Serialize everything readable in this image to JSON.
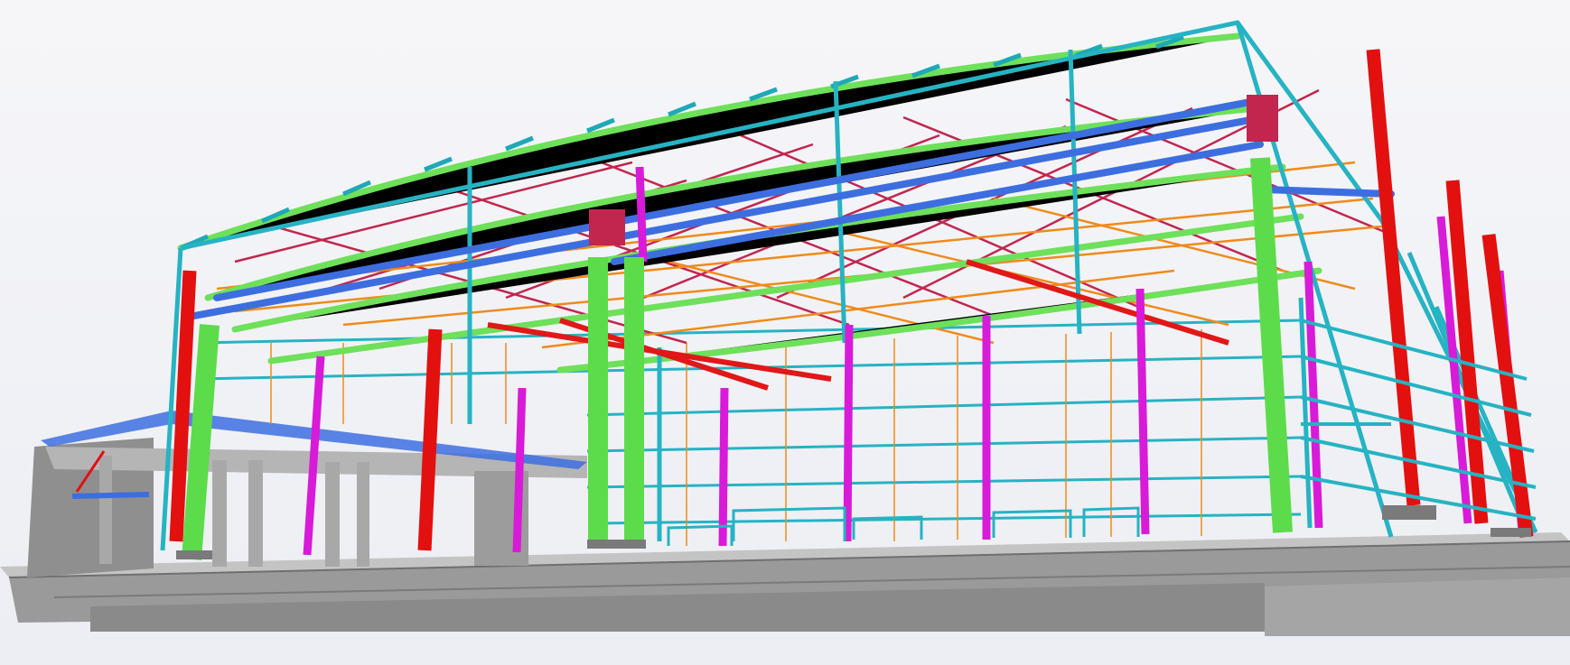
{
  "viewport": {
    "title": ""
  },
  "colors": {
    "background": "#f2f3f7",
    "concrete_top": "#bdbdbd",
    "concrete_side": "#8e8e8e",
    "concrete_dark": "#6f6f6f",
    "column_red": "#e31010",
    "column_green": "#5cdc4a",
    "column_magenta": "#d81bd8",
    "rafter_green": "#6ee05a",
    "frame_teal": "#26b3c3",
    "purlin_teal": "#1fa8b8",
    "crane_blue": "#3d6ee0",
    "brace_crimson": "#c2264f",
    "brace_orange": "#f08a1a",
    "crane_red": "#e01818"
  },
  "model": {
    "element_types": [
      "foundation-slab",
      "columns",
      "rafters",
      "purlins",
      "bracing",
      "crane-beams",
      "wall-girts",
      "annex-canopy"
    ]
  }
}
